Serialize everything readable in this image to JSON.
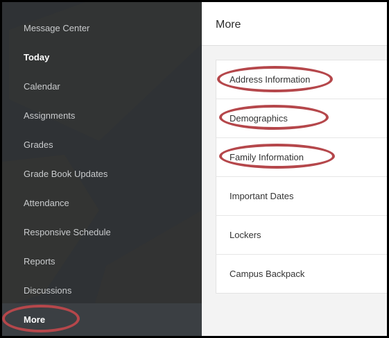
{
  "sidebar": {
    "items": [
      {
        "label": "Message Center"
      },
      {
        "label": "Today"
      },
      {
        "label": "Calendar"
      },
      {
        "label": "Assignments"
      },
      {
        "label": "Grades"
      },
      {
        "label": "Grade Book Updates"
      },
      {
        "label": "Attendance"
      },
      {
        "label": "Responsive Schedule"
      },
      {
        "label": "Reports"
      },
      {
        "label": "Discussions"
      },
      {
        "label": "More"
      }
    ]
  },
  "main": {
    "title": "More",
    "links": [
      {
        "label": "Address Information"
      },
      {
        "label": "Demographics"
      },
      {
        "label": "Family Information"
      },
      {
        "label": "Important Dates"
      },
      {
        "label": "Lockers"
      },
      {
        "label": "Campus Backpack"
      }
    ]
  },
  "colors": {
    "sidebar_bg": "#2f3235",
    "highlight_oval": "#b5474b",
    "content_bg": "#f3f3f3"
  }
}
